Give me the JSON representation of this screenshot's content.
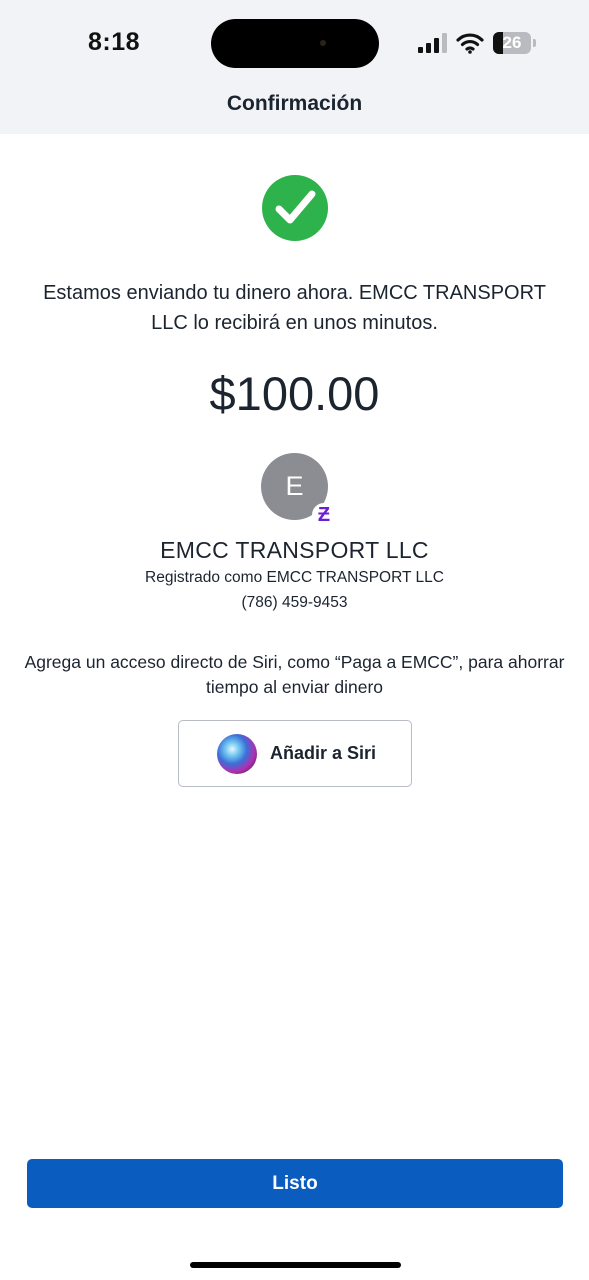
{
  "status_bar": {
    "time": "8:18",
    "battery_level": "26",
    "icons": [
      "cellular-signal-icon",
      "wifi-icon",
      "battery-icon"
    ]
  },
  "header": {
    "title": "Confirmación"
  },
  "confirmation": {
    "icon": "check-circle-icon",
    "icon_color": "#2eb24b",
    "message": "Estamos enviando tu dinero ahora. EMCC TRANSPORT LLC lo recibirá en unos minutos.",
    "amount": "$100.00"
  },
  "recipient": {
    "avatar_initial": "E",
    "badge_icon": "zelle-icon",
    "badge_glyph": "Ƶ",
    "badge_color": "#6d1ed4",
    "name": "EMCC TRANSPORT LLC",
    "registered_as": "Registrado como EMCC TRANSPORT LLC",
    "phone": "(786) 459-9453"
  },
  "siri": {
    "hint": "Agrega un acceso directo de Siri, como “Paga a EMCC”, para ahorrar tiempo al enviar dinero",
    "button_icon": "siri-icon",
    "button_label": "Añadir a Siri"
  },
  "footer": {
    "done_label": "Listo",
    "button_color": "#0a5cbf"
  }
}
